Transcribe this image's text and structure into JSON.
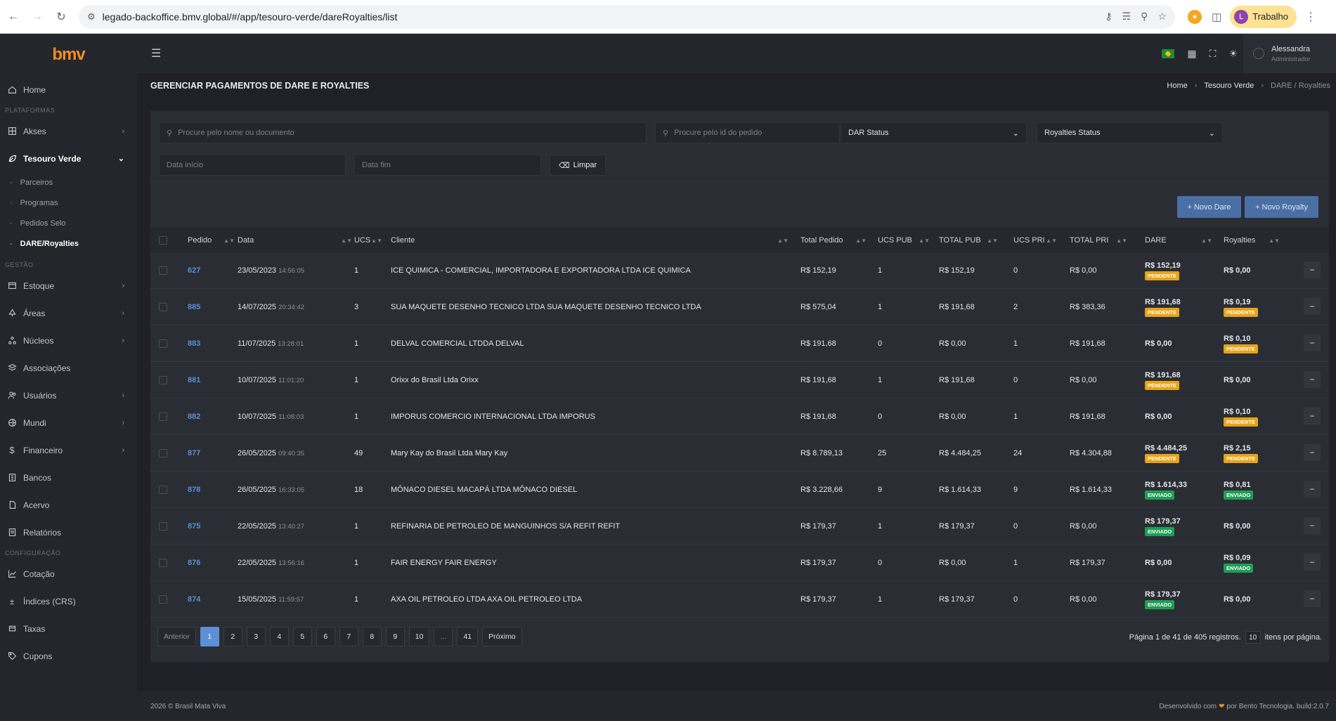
{
  "browser": {
    "url": "legado-backoffice.bmv.global/#/app/tesouro-verde/dareRoyalties/list",
    "profile_initial": "L",
    "profile_label": "Trabalho"
  },
  "app": {
    "logo": "bmv",
    "page_title": "GERENCIAR PAGAMENTOS DE DARE E ROYALTIES",
    "user_name": "Alessandra",
    "user_role": "Administrador"
  },
  "breadcrumb": [
    "Home",
    "Tesouro Verde",
    "DARE / Royalties"
  ],
  "sidebar": {
    "home": "Home",
    "sec_plataformas": "PLATAFORMAS",
    "akses": "Akses",
    "tesouro": "Tesouro Verde",
    "sub": [
      "Parceiros",
      "Programas",
      "Pedidos Selo",
      "DARE/Royalties"
    ],
    "sec_gestao": "GESTÃO",
    "gestao": [
      "Estoque",
      "Áreas",
      "Núcleos",
      "Associações",
      "Usuários",
      "Mundi",
      "Financeiro",
      "Bancos",
      "Acervo",
      "Relatórios"
    ],
    "sec_config": "CONFIGURAÇÃO",
    "config": [
      "Cotação",
      "Índices (CRS)",
      "Taxas",
      "Cupons"
    ]
  },
  "filters": {
    "search_name_placeholder": "Procure pelo nome ou documento",
    "search_id_placeholder": "Procure pelo id do pedido",
    "dar_status": "DAR Status",
    "royalties_status": "Royalties Status",
    "date_start_placeholder": "Data início",
    "date_end_placeholder": "Data fim",
    "clear_label": "Limpar"
  },
  "actions": {
    "new_dare": "+ Novo Dare",
    "new_royalty": "+ Novo Royalty"
  },
  "table": {
    "headers": [
      "Pedido",
      "Data",
      "UCS",
      "Cliente",
      "Total Pedido",
      "UCS PUB",
      "TOTAL PUB",
      "UCS PRI",
      "TOTAL PRI",
      "DARE",
      "Royalties"
    ],
    "rows": [
      {
        "pedido": "627",
        "data": "23/05/2023",
        "hora": "14:56:05",
        "ucs": "1",
        "cliente": "ICE QUIMICA - COMERCIAL, IMPORTADORA E EXPORTADORA LTDA ICE QUIMICA",
        "total": "R$ 152,19",
        "ucs_pub": "1",
        "total_pub": "R$ 152,19",
        "ucs_pri": "0",
        "total_pri": "R$ 0,00",
        "dare": "R$ 152,19",
        "dare_status": "PENDENTE",
        "royalty": "R$ 0,00",
        "royalty_status": ""
      },
      {
        "pedido": "885",
        "data": "14/07/2025",
        "hora": "20:34:42",
        "ucs": "3",
        "cliente": "SUA MAQUETE DESENHO TECNICO LTDA SUA MAQUETE DESENHO TECNICO LTDA",
        "total": "R$ 575,04",
        "ucs_pub": "1",
        "total_pub": "R$ 191,68",
        "ucs_pri": "2",
        "total_pri": "R$ 383,36",
        "dare": "R$ 191,68",
        "dare_status": "PENDENTE",
        "royalty": "R$ 0,19",
        "royalty_status": "PENDENTE"
      },
      {
        "pedido": "883",
        "data": "11/07/2025",
        "hora": "13:28:01",
        "ucs": "1",
        "cliente": "DELVAL COMERCIAL LTDDA DELVAL",
        "total": "R$ 191,68",
        "ucs_pub": "0",
        "total_pub": "R$ 0,00",
        "ucs_pri": "1",
        "total_pri": "R$ 191,68",
        "dare": "R$ 0,00",
        "dare_status": "",
        "royalty": "R$ 0,10",
        "royalty_status": "PENDENTE"
      },
      {
        "pedido": "881",
        "data": "10/07/2025",
        "hora": "11:01:20",
        "ucs": "1",
        "cliente": "Orixx do Brasil Ltda Orixx",
        "total": "R$ 191,68",
        "ucs_pub": "1",
        "total_pub": "R$ 191,68",
        "ucs_pri": "0",
        "total_pri": "R$ 0,00",
        "dare": "R$ 191,68",
        "dare_status": "PENDENTE",
        "royalty": "R$ 0,00",
        "royalty_status": ""
      },
      {
        "pedido": "882",
        "data": "10/07/2025",
        "hora": "11:08:03",
        "ucs": "1",
        "cliente": "IMPORUS COMERCIO INTERNACIONAL LTDA IMPORUS",
        "total": "R$ 191,68",
        "ucs_pub": "0",
        "total_pub": "R$ 0,00",
        "ucs_pri": "1",
        "total_pri": "R$ 191,68",
        "dare": "R$ 0,00",
        "dare_status": "",
        "royalty": "R$ 0,10",
        "royalty_status": "PENDENTE"
      },
      {
        "pedido": "877",
        "data": "26/05/2025",
        "hora": "09:40:35",
        "ucs": "49",
        "cliente": "Mary Kay do Brasil Ltda Mary Kay",
        "total": "R$ 8.789,13",
        "ucs_pub": "25",
        "total_pub": "R$ 4.484,25",
        "ucs_pri": "24",
        "total_pri": "R$ 4.304,88",
        "dare": "R$ 4.484,25",
        "dare_status": "PENDENTE",
        "royalty": "R$ 2,15",
        "royalty_status": "PENDENTE"
      },
      {
        "pedido": "878",
        "data": "26/05/2025",
        "hora": "16:33:05",
        "ucs": "18",
        "cliente": "MÔNACO DIESEL MACAPÁ LTDA MÔNACO DIESEL",
        "total": "R$ 3.228,66",
        "ucs_pub": "9",
        "total_pub": "R$ 1.614,33",
        "ucs_pri": "9",
        "total_pri": "R$ 1.614,33",
        "dare": "R$ 1.614,33",
        "dare_status": "ENVIADO",
        "royalty": "R$ 0,81",
        "royalty_status": "ENVIADO"
      },
      {
        "pedido": "875",
        "data": "22/05/2025",
        "hora": "13:40:27",
        "ucs": "1",
        "cliente": "REFINARIA DE PETROLEO DE MANGUINHOS S/A REFIT REFIT",
        "total": "R$ 179,37",
        "ucs_pub": "1",
        "total_pub": "R$ 179,37",
        "ucs_pri": "0",
        "total_pri": "R$ 0,00",
        "dare": "R$ 179,37",
        "dare_status": "ENVIADO",
        "royalty": "R$ 0,00",
        "royalty_status": ""
      },
      {
        "pedido": "876",
        "data": "22/05/2025",
        "hora": "13:56:16",
        "ucs": "1",
        "cliente": "FAIR ENERGY FAIR ENERGY",
        "total": "R$ 179,37",
        "ucs_pub": "0",
        "total_pub": "R$ 0,00",
        "ucs_pri": "1",
        "total_pri": "R$ 179,37",
        "dare": "R$ 0,00",
        "dare_status": "",
        "royalty": "R$ 0,09",
        "royalty_status": "ENVIADO"
      },
      {
        "pedido": "874",
        "data": "15/05/2025",
        "hora": "11:59:57",
        "ucs": "1",
        "cliente": "AXA OIL PETROLEO LTDA AXA OIL PETROLEO LTDA",
        "total": "R$ 179,37",
        "ucs_pub": "1",
        "total_pub": "R$ 179,37",
        "ucs_pri": "0",
        "total_pri": "R$ 0,00",
        "dare": "R$ 179,37",
        "dare_status": "ENVIADO",
        "royalty": "R$ 0,00",
        "royalty_status": ""
      }
    ]
  },
  "pagination": {
    "prev": "Anterior",
    "pages": [
      "1",
      "2",
      "3",
      "4",
      "5",
      "6",
      "7",
      "8",
      "9",
      "10",
      "...",
      "41"
    ],
    "next": "Próximo",
    "info": "Página 1 de 41 de 405 registros.",
    "per_page": "10",
    "per_page_label": "itens por página."
  },
  "footer": {
    "left": "2026 © Brasil Mata Viva",
    "right_prefix": "Desenvolvido com",
    "right_suffix": "por Bento Tecnologia. build:2.0.7"
  },
  "colors": {
    "accent": "#5b8fd6",
    "pending": "#e8a317",
    "sent": "#1f9d55",
    "logo": "#f28c28"
  }
}
